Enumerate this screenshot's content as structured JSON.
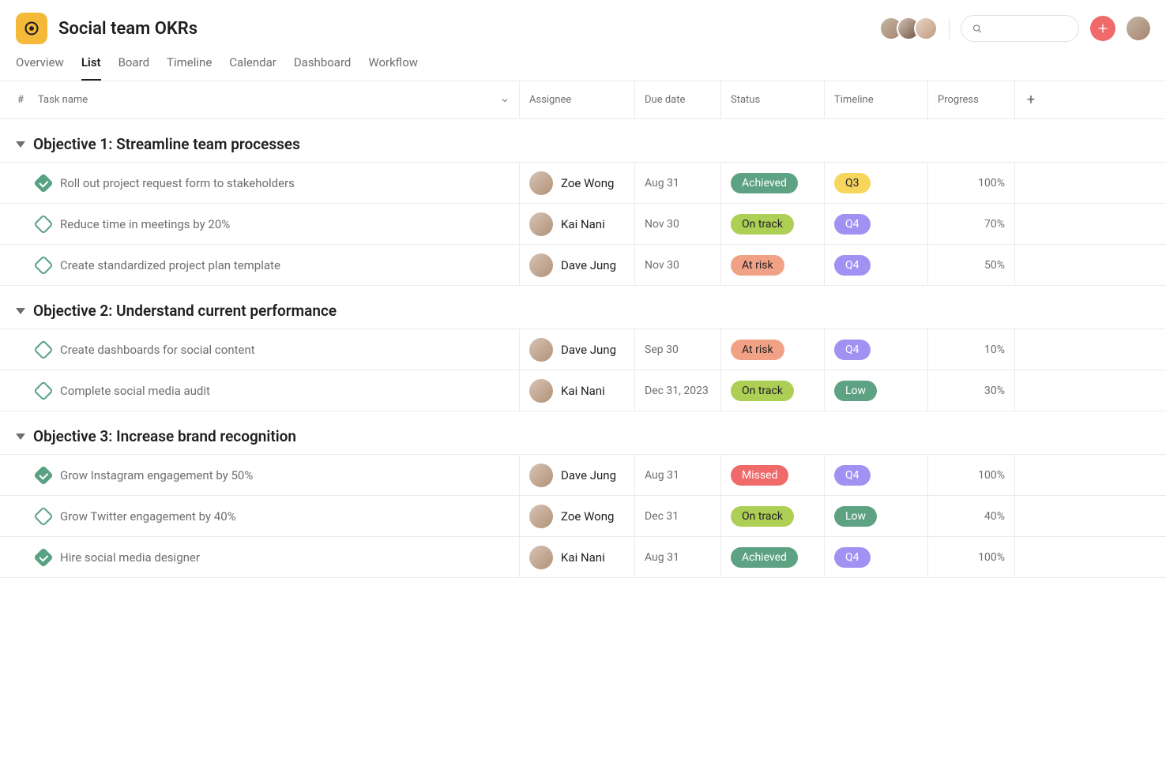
{
  "header": {
    "title": "Social team OKRs",
    "search_placeholder": ""
  },
  "tabs": [
    "Overview",
    "List",
    "Board",
    "Timeline",
    "Calendar",
    "Dashboard",
    "Workflow"
  ],
  "active_tab": "List",
  "columns": {
    "row_num": "#",
    "task_name": "Task name",
    "assignee": "Assignee",
    "due_date": "Due date",
    "status": "Status",
    "timeline": "Timeline",
    "progress": "Progress"
  },
  "status_styles": {
    "Achieved": "pill-achieved",
    "On track": "pill-ontrack",
    "At risk": "pill-atrisk",
    "Missed": "pill-missed"
  },
  "timeline_styles": {
    "Q3": "pill-q3",
    "Q4": "pill-q4",
    "Low": "pill-low"
  },
  "sections": [
    {
      "title": "Objective 1: Streamline team processes",
      "rows": [
        {
          "done": true,
          "name": "Roll out project request form to stakeholders",
          "assignee": "Zoe Wong",
          "due": "Aug 31",
          "status": "Achieved",
          "timeline": "Q3",
          "progress": "100%"
        },
        {
          "done": false,
          "name": "Reduce time in meetings by 20%",
          "assignee": "Kai Nani",
          "due": "Nov 30",
          "status": "On track",
          "timeline": "Q4",
          "progress": "70%"
        },
        {
          "done": false,
          "name": "Create standardized project plan template",
          "assignee": "Dave Jung",
          "due": "Nov 30",
          "status": "At risk",
          "timeline": "Q4",
          "progress": "50%"
        }
      ]
    },
    {
      "title": "Objective 2: Understand current performance",
      "rows": [
        {
          "done": false,
          "name": "Create dashboards for social content",
          "assignee": "Dave Jung",
          "due": "Sep 30",
          "status": "At risk",
          "timeline": "Q4",
          "progress": "10%"
        },
        {
          "done": false,
          "name": "Complete social media audit",
          "assignee": "Kai Nani",
          "due": "Dec 31, 2023",
          "status": "On track",
          "timeline": "Low",
          "progress": "30%"
        }
      ]
    },
    {
      "title": "Objective 3: Increase brand recognition",
      "rows": [
        {
          "done": true,
          "name": "Grow Instagram engagement by 50%",
          "assignee": "Dave Jung",
          "due": "Aug 31",
          "status": "Missed",
          "timeline": "Q4",
          "progress": "100%"
        },
        {
          "done": false,
          "name": "Grow Twitter engagement by 40%",
          "assignee": "Zoe Wong",
          "due": "Dec 31",
          "status": "On track",
          "timeline": "Low",
          "progress": "40%"
        },
        {
          "done": true,
          "name": "Hire social media designer",
          "assignee": "Kai Nani",
          "due": "Aug 31",
          "status": "Achieved",
          "timeline": "Q4",
          "progress": "100%"
        }
      ]
    }
  ]
}
